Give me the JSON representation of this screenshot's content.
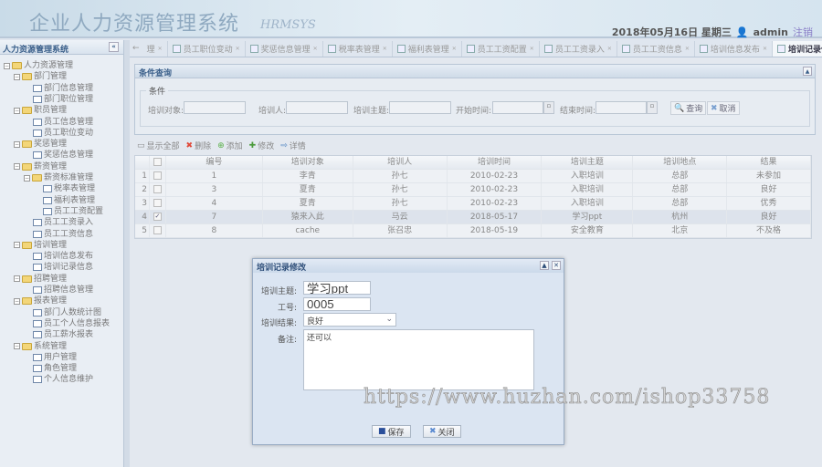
{
  "header": {
    "title": "企业人力资源管理系统",
    "subtitle": "HRMSYS",
    "date": "2018年05月16日 星期三",
    "user": "admin",
    "logout": "注销"
  },
  "sidebar": {
    "title": "人力资源管理系统",
    "collapse": "«",
    "items": [
      {
        "label": "人力资源管理",
        "level": 0,
        "type": "folder"
      },
      {
        "label": "部门管理",
        "level": 1,
        "type": "folder"
      },
      {
        "label": "部门信息管理",
        "level": 2,
        "type": "leaf"
      },
      {
        "label": "部门职位管理",
        "level": 2,
        "type": "leaf"
      },
      {
        "label": "职员管理",
        "level": 1,
        "type": "folder"
      },
      {
        "label": "员工信息管理",
        "level": 2,
        "type": "leaf"
      },
      {
        "label": "员工职位变动",
        "level": 2,
        "type": "leaf"
      },
      {
        "label": "奖惩管理",
        "level": 1,
        "type": "folder"
      },
      {
        "label": "奖惩信息管理",
        "level": 2,
        "type": "leaf"
      },
      {
        "label": "薪资管理",
        "level": 1,
        "type": "folder"
      },
      {
        "label": "薪资标准管理",
        "level": 2,
        "type": "folder"
      },
      {
        "label": "税率表管理",
        "level": 3,
        "type": "leaf"
      },
      {
        "label": "福利表管理",
        "level": 3,
        "type": "leaf"
      },
      {
        "label": "员工工资配置",
        "level": 3,
        "type": "leaf"
      },
      {
        "label": "员工工资录入",
        "level": 2,
        "type": "leaf"
      },
      {
        "label": "员工工资信息",
        "level": 2,
        "type": "leaf"
      },
      {
        "label": "培训管理",
        "level": 1,
        "type": "folder"
      },
      {
        "label": "培训信息发布",
        "level": 2,
        "type": "leaf"
      },
      {
        "label": "培训记录信息",
        "level": 2,
        "type": "leaf"
      },
      {
        "label": "招聘管理",
        "level": 1,
        "type": "folder"
      },
      {
        "label": "招聘信息管理",
        "level": 2,
        "type": "leaf"
      },
      {
        "label": "报表管理",
        "level": 1,
        "type": "folder"
      },
      {
        "label": "部门人数统计图",
        "level": 2,
        "type": "leaf"
      },
      {
        "label": "员工个人信息报表",
        "level": 2,
        "type": "leaf"
      },
      {
        "label": "员工薪水报表",
        "level": 2,
        "type": "leaf"
      },
      {
        "label": "系统管理",
        "level": 1,
        "type": "folder"
      },
      {
        "label": "用户管理",
        "level": 2,
        "type": "leaf"
      },
      {
        "label": "角色管理",
        "level": 2,
        "type": "leaf"
      },
      {
        "label": "个人信息维护",
        "level": 2,
        "type": "leaf"
      }
    ]
  },
  "tabs": [
    {
      "label": "理"
    },
    {
      "label": "员工职位变动"
    },
    {
      "label": "奖惩信息管理"
    },
    {
      "label": "税率表管理"
    },
    {
      "label": "福利表管理"
    },
    {
      "label": "员工工资配置"
    },
    {
      "label": "员工工资录入"
    },
    {
      "label": "员工工资信息"
    },
    {
      "label": "培训信息发布"
    },
    {
      "label": "培训记录信息",
      "active": true
    }
  ],
  "query": {
    "title": "条件查询",
    "legend": "条件",
    "target": "培训对象:",
    "trainer": "培训人:",
    "topic": "培训主题:",
    "start": "开始时间:",
    "end": "结束时间:",
    "search": "查询",
    "cancel": "取消"
  },
  "toolbar": {
    "show_all": "显示全部",
    "delete": "删除",
    "add": "添加",
    "edit": "修改",
    "detail": "详情"
  },
  "grid": {
    "columns": [
      "编号",
      "培训对象",
      "培训人",
      "培训时间",
      "培训主题",
      "培训地点",
      "结果"
    ],
    "rows": [
      {
        "n": "1",
        "checked": false,
        "cells": [
          "1",
          "李青",
          "孙七",
          "2010-02-23",
          "入职培训",
          "总部",
          "未参加"
        ]
      },
      {
        "n": "2",
        "checked": false,
        "cells": [
          "3",
          "夏青",
          "孙七",
          "2010-02-23",
          "入职培训",
          "总部",
          "良好"
        ]
      },
      {
        "n": "3",
        "checked": false,
        "cells": [
          "4",
          "夏青",
          "孙七",
          "2010-02-23",
          "入职培训",
          "总部",
          "优秀"
        ]
      },
      {
        "n": "4",
        "checked": true,
        "cells": [
          "7",
          "猿来入此",
          "马云",
          "2018-05-17",
          "学习ppt",
          "杭州",
          "良好"
        ]
      },
      {
        "n": "5",
        "checked": false,
        "cells": [
          "8",
          "cache",
          "张召忠",
          "2018-05-19",
          "安全教育",
          "北京",
          "不及格"
        ]
      }
    ]
  },
  "dialog": {
    "title": "培训记录修改",
    "topic_label": "培训主题:",
    "topic": "学习ppt",
    "id_label": "工号:",
    "id": "0005",
    "result_label": "培训结果:",
    "result": "良好",
    "note_label": "备注:",
    "note": "还可以",
    "save": "保存",
    "close": "关闭"
  },
  "watermark": "https://www.huzhan.com/ishop33758"
}
